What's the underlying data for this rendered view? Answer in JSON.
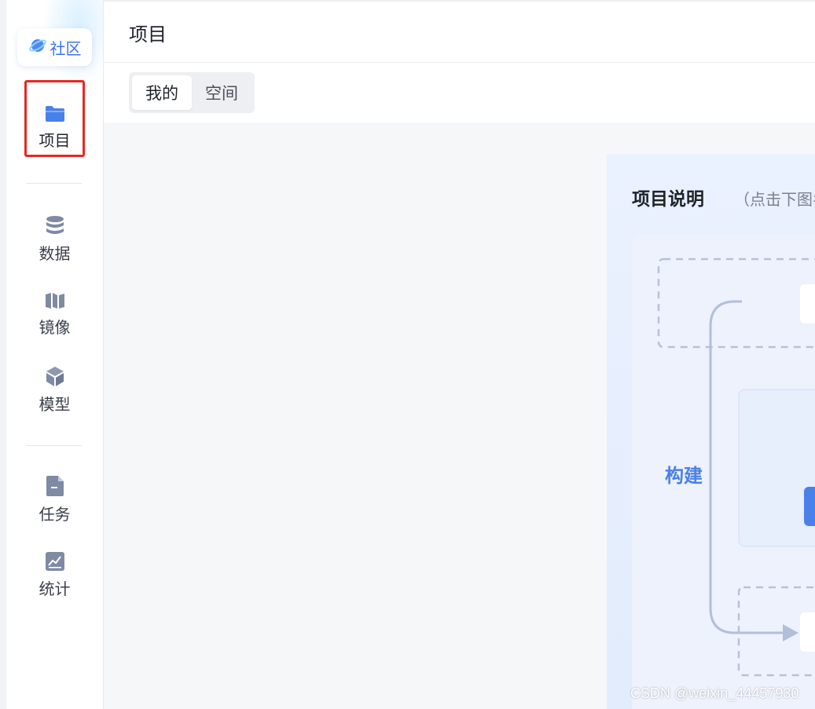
{
  "sidebar": {
    "community_label": "社区",
    "items": [
      {
        "label": "项目",
        "icon": "folder-icon",
        "active": true
      },
      {
        "label": "数据",
        "icon": "database-icon"
      },
      {
        "label": "镜像",
        "icon": "map-icon"
      },
      {
        "label": "模型",
        "icon": "cube-icon"
      },
      {
        "label": "任务",
        "icon": "file-icon"
      },
      {
        "label": "统计",
        "icon": "chart-icon"
      }
    ]
  },
  "header": {
    "title": "项目"
  },
  "tabs": [
    {
      "label": "我的",
      "active": true
    },
    {
      "label": "空间"
    }
  ],
  "panel": {
    "title": "项目说明",
    "hint": "（点击下图名",
    "diagram_label": "构建"
  },
  "watermark": "CSDN @weixin_44457930",
  "colors": {
    "accent": "#3b74f0",
    "active_icon": "#4a80ea",
    "icon_gray": "#7f8aa3",
    "highlight": "#e8281f"
  }
}
